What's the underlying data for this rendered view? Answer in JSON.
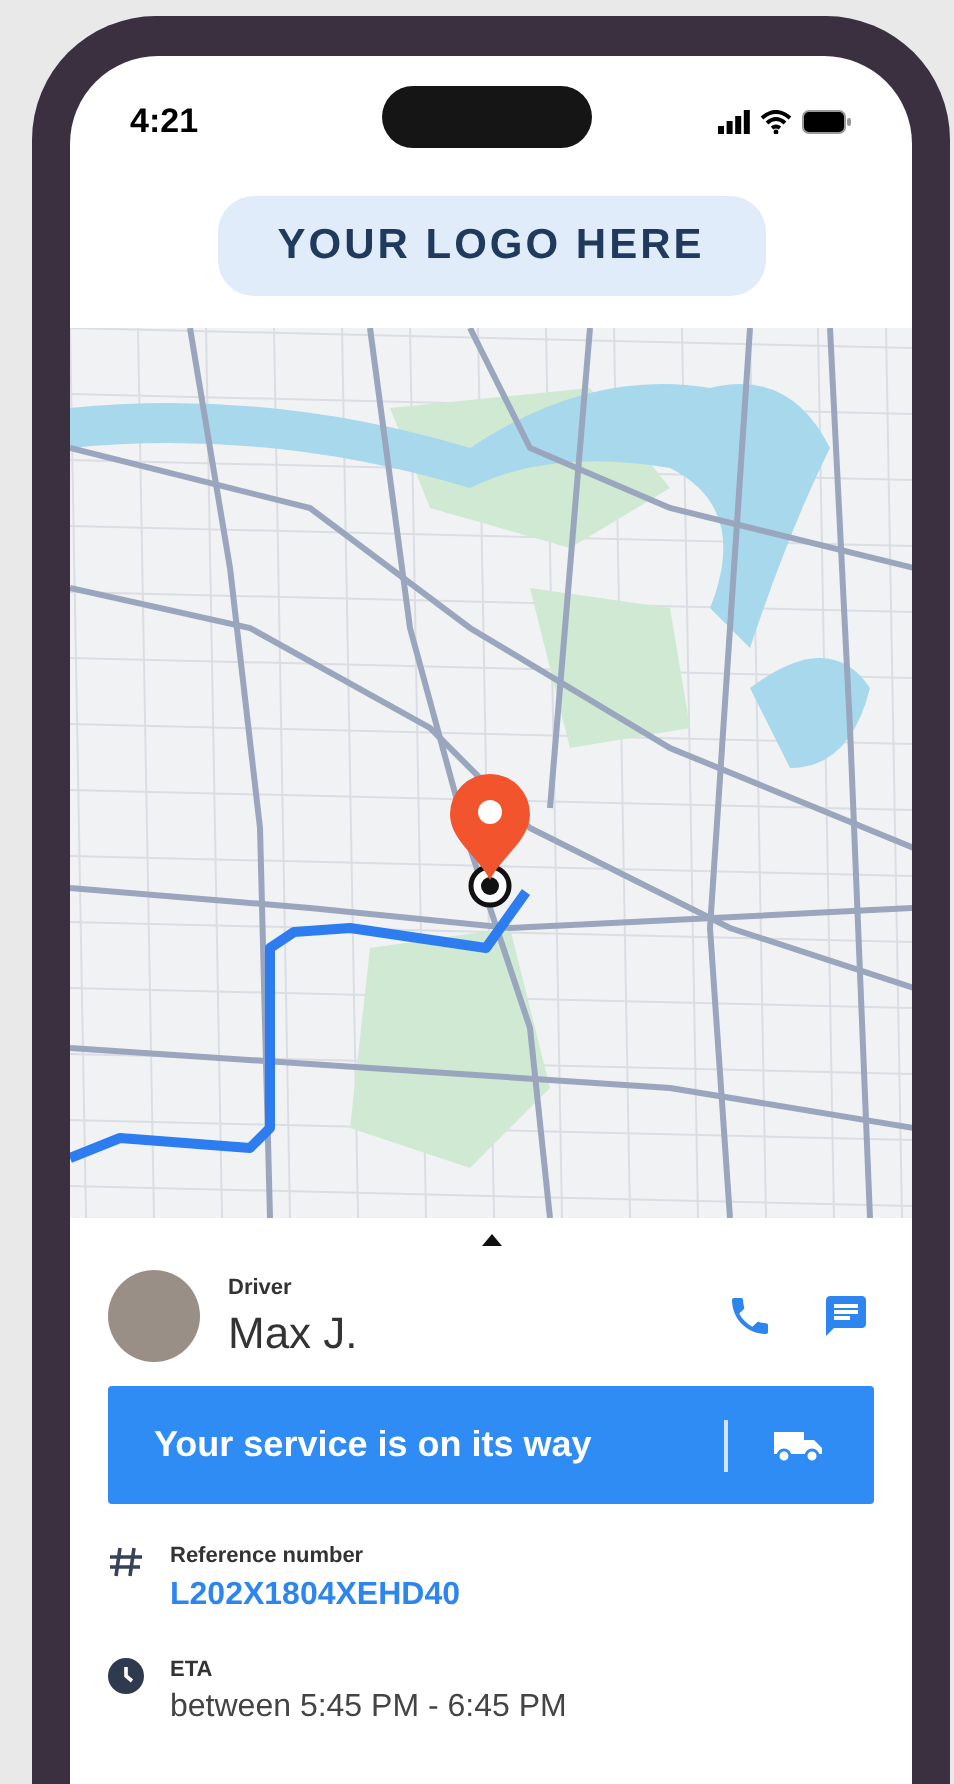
{
  "status_bar": {
    "time": "4:21"
  },
  "logo": {
    "text": "YOUR LOGO HERE"
  },
  "driver": {
    "label": "Driver",
    "name": "Max J."
  },
  "status_banner": {
    "text": "Your service is on its way"
  },
  "details": [
    {
      "kind": "reference",
      "label": "Reference number",
      "value": "L202X1804XEHD40"
    },
    {
      "kind": "eta",
      "label": "ETA",
      "value": "between 5:45 PM - 6:45 PM"
    }
  ]
}
